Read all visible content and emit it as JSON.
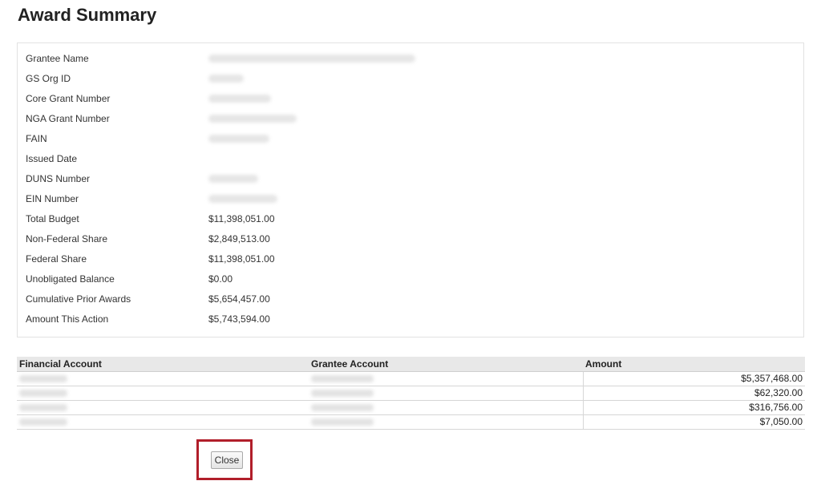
{
  "page": {
    "title": "Award Summary"
  },
  "summary": {
    "fields": [
      {
        "label": "Grantee Name",
        "value": null
      },
      {
        "label": "GS Org ID",
        "value": null
      },
      {
        "label": "Core Grant Number",
        "value": null
      },
      {
        "label": "NGA Grant Number",
        "value": null
      },
      {
        "label": "FAIN",
        "value": null
      },
      {
        "label": "Issued Date",
        "value": ""
      },
      {
        "label": "DUNS Number",
        "value": null
      },
      {
        "label": "EIN Number",
        "value": null
      },
      {
        "label": "Total Budget",
        "value": "$11,398,051.00"
      },
      {
        "label": "Non-Federal Share",
        "value": "$2,849,513.00"
      },
      {
        "label": "Federal Share",
        "value": "$11,398,051.00"
      },
      {
        "label": "Unobligated Balance",
        "value": "$0.00"
      },
      {
        "label": "Cumulative Prior Awards",
        "value": "$5,654,457.00"
      },
      {
        "label": "Amount This Action",
        "value": "$5,743,594.00"
      }
    ]
  },
  "accounts_table": {
    "headers": [
      "Financial Account",
      "Grantee Account",
      "Amount"
    ],
    "rows": [
      {
        "amount": "$5,357,468.00"
      },
      {
        "amount": "$62,320.00"
      },
      {
        "amount": "$316,756.00"
      },
      {
        "amount": "$7,050.00"
      }
    ]
  },
  "actions": {
    "close_label": "Close"
  },
  "colors": {
    "highlight_border": "#b11e2a",
    "table_header_bg": "#e8e8e8"
  }
}
